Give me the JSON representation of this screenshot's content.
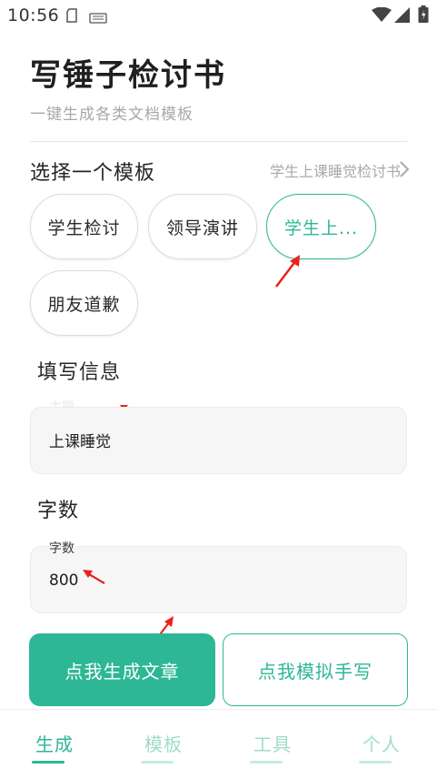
{
  "status_bar": {
    "time": "10:56"
  },
  "header": {
    "title": "写锤子检讨书",
    "subtitle": "一键生成各类文档模板"
  },
  "template_section": {
    "title": "选择一个模板",
    "selected": "学生上课睡觉检讨书",
    "chips": [
      "学生检讨",
      "领导演讲",
      "学生上...",
      "朋友道歉"
    ]
  },
  "info_section": {
    "title": "填写信息",
    "theme_field": {
      "label": "主题",
      "value": "上课睡觉"
    }
  },
  "wordcount_section": {
    "title": "字数",
    "field": {
      "label": "字数",
      "value": "800"
    }
  },
  "buttons": {
    "generate": "点我生成文章",
    "handwrite": "点我模拟手写"
  },
  "nav": {
    "items": [
      "生成",
      "模板",
      "工具",
      "个人"
    ],
    "active_index": 0
  },
  "colors": {
    "accent": "#2db796",
    "accent_light": "#9fdcc9",
    "annotation_arrow": "#e8231a"
  }
}
